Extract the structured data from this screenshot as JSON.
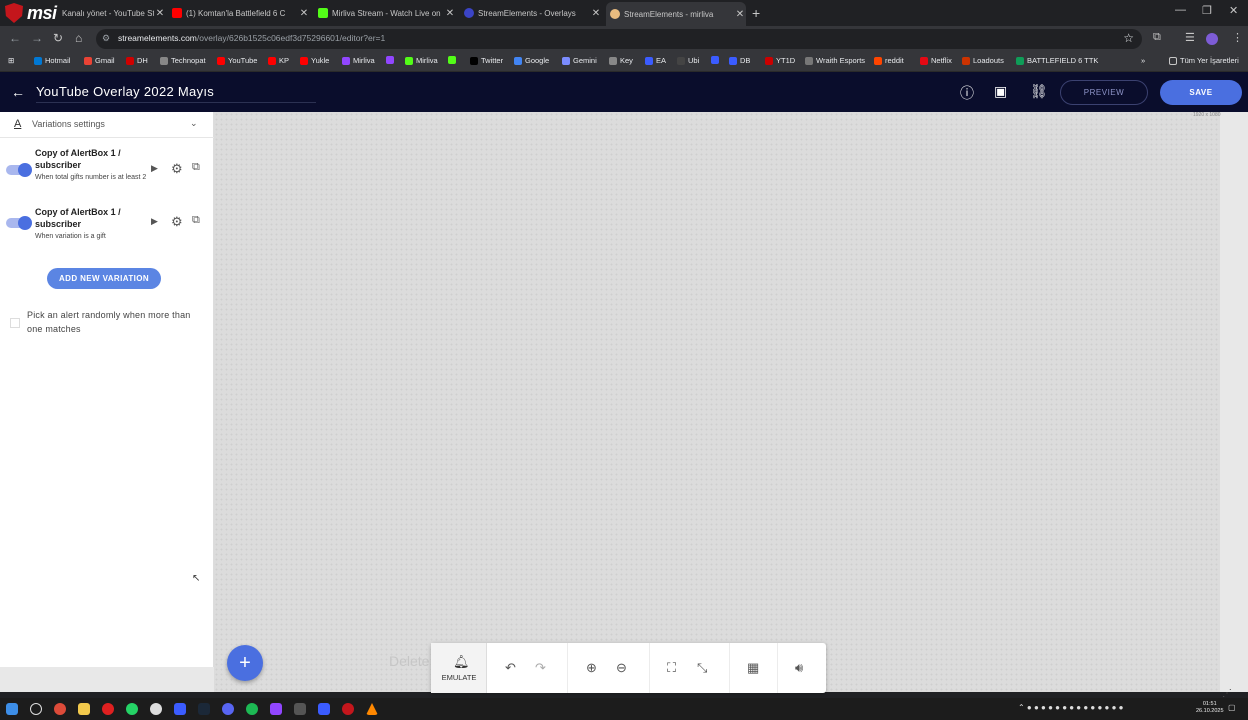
{
  "browser": {
    "tabs": [
      {
        "label": "Kanalı yönet - YouTube Studio",
        "color": "#ff0000"
      },
      {
        "label": "(1) Komtan'la Battlefield 6 C",
        "color": "#ff0000"
      },
      {
        "label": "Mirliva Stream - Watch Live on",
        "color": "#53fc18"
      },
      {
        "label": "StreamElements - Overlays",
        "color": "#3b44c6"
      },
      {
        "label": "StreamElements - mirliva",
        "color": "#e8bb7f"
      }
    ],
    "url_host": "streamelements.com",
    "url_path": "/overlay/626b1525c06edf3d75296601/editor?er=1",
    "bookmarks": [
      {
        "label": "Hotmail",
        "color": "#0078d4"
      },
      {
        "label": "Gmail",
        "color": "#ea4335"
      },
      {
        "label": "DH",
        "color": "#d00000"
      },
      {
        "label": "Technopat",
        "color": "#888888"
      },
      {
        "label": "YouTube",
        "color": "#ff0000"
      },
      {
        "label": "KP",
        "color": "#ff0000"
      },
      {
        "label": "Yukle",
        "color": "#ff0000"
      },
      {
        "label": "Mirliva",
        "color": "#9146ff"
      },
      {
        "label": "",
        "color": "#9146ff"
      },
      {
        "label": "Mirliva",
        "color": "#53fc18"
      },
      {
        "label": "",
        "color": "#53fc18"
      },
      {
        "label": "Twitter",
        "color": "#000000"
      },
      {
        "label": "Google",
        "color": "#4285f4"
      },
      {
        "label": "Gemini",
        "color": "#7b8cff"
      },
      {
        "label": "Key",
        "color": "#888888"
      },
      {
        "label": "EA",
        "color": "#3b5cff"
      },
      {
        "label": "Ubi",
        "color": "#444444"
      },
      {
        "label": "",
        "color": "#3b5cff"
      },
      {
        "label": "DB",
        "color": "#3b5cff"
      },
      {
        "label": "YT1D",
        "color": "#cc0000"
      },
      {
        "label": "Wraith Esports",
        "color": "#777777"
      },
      {
        "label": "reddit",
        "color": "#ff4500"
      },
      {
        "label": "Netflix",
        "color": "#e50914"
      },
      {
        "label": "Loadouts",
        "color": "#cc3300"
      },
      {
        "label": "BATTLEFIELD 6 TTK",
        "color": "#0f9d58"
      }
    ],
    "bookmarks_more": "»",
    "all_bookmarks": "Tüm Yer İşaretleri"
  },
  "header": {
    "title": "YouTube Overlay 2022 Mayıs",
    "preview_label": "PREVIEW",
    "save_label": "SAVE"
  },
  "panel": {
    "section_title": "Variations settings",
    "variations": [
      {
        "name": "Copy of AlertBox 1 / subscriber",
        "desc": "When total gifts number is at least 2",
        "enabled": true
      },
      {
        "name": "Copy of AlertBox 1 / subscriber",
        "desc": "When variation is a gift",
        "enabled": true
      }
    ],
    "add_variation_label": "ADD NEW VARIATION",
    "random_pick_label": "Pick an alert randomly when more than one matches"
  },
  "canvas": {
    "resolution": "1920 x 1080",
    "ghost_text": "Delete"
  },
  "toolbar": {
    "emulate_label": "EMULATE"
  },
  "taskbar": {
    "time": "01:51",
    "date": "26.10.2025"
  },
  "colors": {
    "accent": "#4a6fe0",
    "header_bg": "#0a0d2c"
  }
}
